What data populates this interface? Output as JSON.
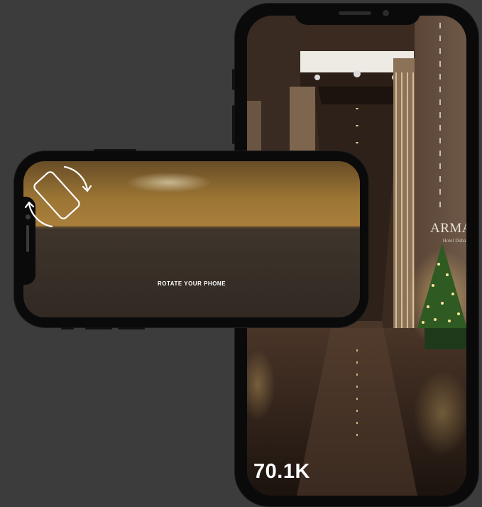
{
  "portrait": {
    "view_count": "70.1K",
    "brand_name": "ARMANI",
    "brand_sub": "Hotel Dubai"
  },
  "landscape": {
    "rotate_message": "ROTATE YOUR PHONE"
  },
  "icons": {
    "rotate": "rotate-phone-icon"
  },
  "colors": {
    "background": "#3c3c3c",
    "device_frame": "#0a0a0a",
    "text": "#ffffff"
  }
}
